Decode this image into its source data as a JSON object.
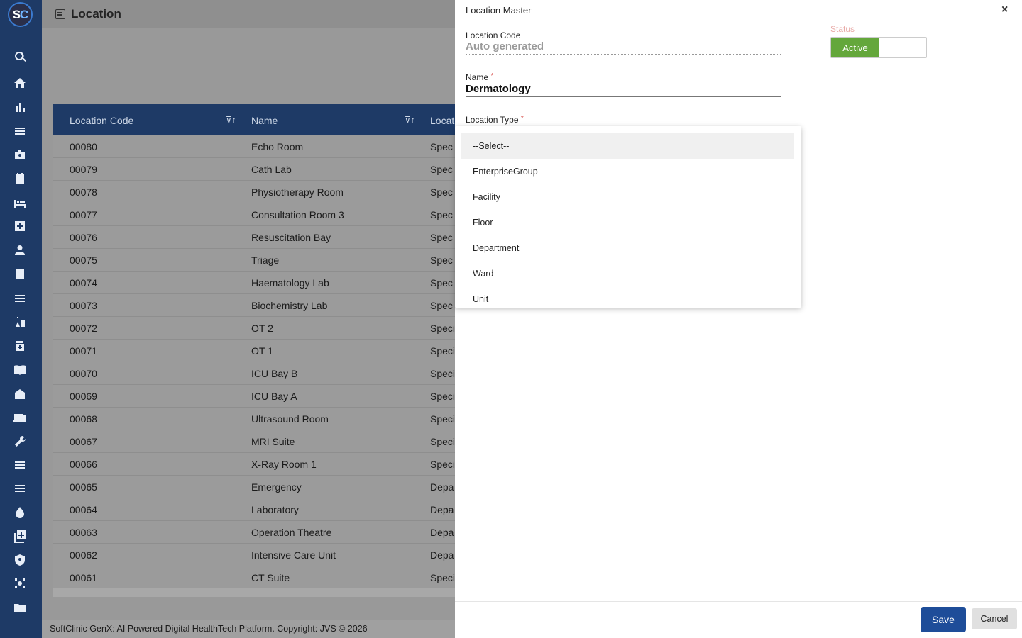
{
  "app": {
    "logo_text_s": "S",
    "logo_text_c": "C",
    "page_title": "Location",
    "footer": "SoftClinic GenX: AI Powered Digital HealthTech Platform. Copyright: JVS © 2026"
  },
  "sidebar": {
    "icons": [
      "search-icon",
      "home-icon",
      "bar-chart-icon",
      "menu-icon",
      "badge-icon",
      "calendar-icon",
      "bed-icon",
      "medical-plus-icon",
      "person-icon",
      "document-icon",
      "list-icon",
      "lab-icon",
      "pharmacy-icon",
      "book-icon",
      "building-icon",
      "devices-icon",
      "wrench-icon",
      "list-icon-2",
      "list-icon-3",
      "drop-icon",
      "add-box-icon",
      "shield-icon",
      "network-icon",
      "folder-icon"
    ]
  },
  "table": {
    "headers": [
      "Location Code",
      "Name",
      "Locati"
    ],
    "rows": [
      {
        "code": "00080",
        "name": "Echo Room",
        "type": "Spec"
      },
      {
        "code": "00079",
        "name": "Cath Lab",
        "type": "Spec"
      },
      {
        "code": "00078",
        "name": "Physiotherapy Room",
        "type": "Spec"
      },
      {
        "code": "00077",
        "name": "Consultation Room 3",
        "type": "Spec"
      },
      {
        "code": "00076",
        "name": "Resuscitation Bay",
        "type": "Spec"
      },
      {
        "code": "00075",
        "name": "Triage",
        "type": "Spec"
      },
      {
        "code": "00074",
        "name": "Haematology Lab",
        "type": "Spec"
      },
      {
        "code": "00073",
        "name": "Biochemistry Lab",
        "type": "Spec"
      },
      {
        "code": "00072",
        "name": "OT 2",
        "type": "Speci"
      },
      {
        "code": "00071",
        "name": "OT 1",
        "type": "Speci"
      },
      {
        "code": "00070",
        "name": "ICU Bay B",
        "type": "Speci"
      },
      {
        "code": "00069",
        "name": "ICU Bay A",
        "type": "Speci"
      },
      {
        "code": "00068",
        "name": "Ultrasound Room",
        "type": "Speci"
      },
      {
        "code": "00067",
        "name": "MRI Suite",
        "type": "Speci"
      },
      {
        "code": "00066",
        "name": "X-Ray Room 1",
        "type": "Speci"
      },
      {
        "code": "00065",
        "name": "Emergency",
        "type": "Depa"
      },
      {
        "code": "00064",
        "name": "Laboratory",
        "type": "Depa"
      },
      {
        "code": "00063",
        "name": "Operation Theatre",
        "type": "Depa"
      },
      {
        "code": "00062",
        "name": "Intensive Care Unit",
        "type": "Depa"
      },
      {
        "code": "00061",
        "name": "CT Suite",
        "type": "Speci"
      }
    ]
  },
  "dialog": {
    "title": "Location Master",
    "close": "×",
    "location_code_label": "Location Code",
    "location_code_value": "Auto generated",
    "name_label": "Name",
    "name_value": "Dermatology",
    "required_mark": "*",
    "location_type_label": "Location Type",
    "status_label": "Status",
    "status_value": "Active",
    "status_color": "#64a73b",
    "dropdown_options": [
      "--Select--",
      "EnterpriseGroup",
      "Facility",
      "Floor",
      "Department",
      "Ward",
      "Unit"
    ],
    "save_label": "Save",
    "cancel_label": "Cancel"
  }
}
